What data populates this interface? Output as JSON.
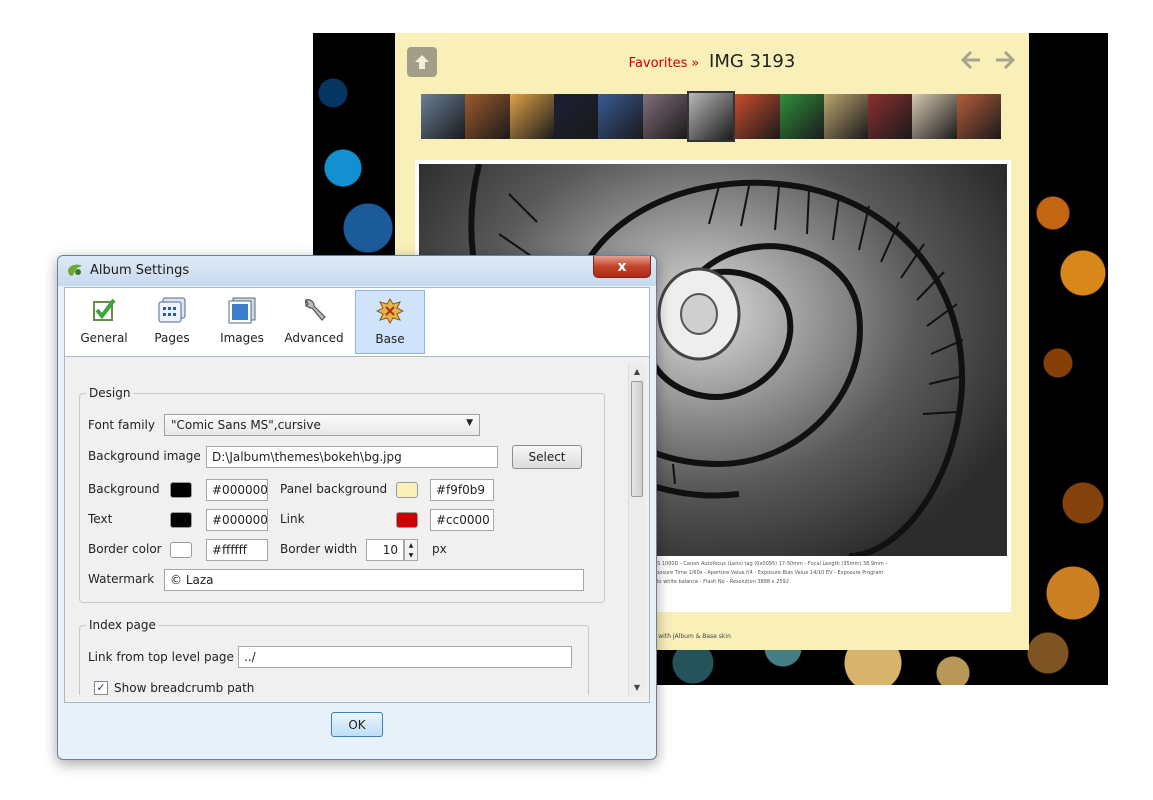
{
  "gallery": {
    "breadcrumb_parent": "Favorites",
    "breadcrumb_separator": "»",
    "image_title": "IMG 3193",
    "thumb_colors": [
      "#6a7f99",
      "#9d5b2b",
      "#e0a247",
      "#1b1f35",
      "#385a95",
      "#826e7b",
      "#b8b8b8",
      "#c84c2b",
      "#2f8f3b",
      "#bca46f",
      "#8c2f2f",
      "#d8c7b2",
      "#b45c3a"
    ],
    "active_thumb": 6,
    "caption_lines": [
      "EOS 1000D - Canon Autofocus (Lens) tag (0x0095) 17-50mm - Focal Length (35mm) 38.9mm -",
      "Exposure Time 1/60s - Aperture Value f/4 - Exposure Bias Value 14/10 EV - Exposure Program",
      "Auto white balance - Flash No - Resolution 3888 x 2592"
    ],
    "credit": "Made with jAlbum & Base skin",
    "accent_color": "#cc0000"
  },
  "dialog": {
    "title": "Album Settings",
    "close_label": "x",
    "tabs": [
      {
        "label": "General",
        "icon": "general-icon"
      },
      {
        "label": "Pages",
        "icon": "pages-icon"
      },
      {
        "label": "Images",
        "icon": "images-icon"
      },
      {
        "label": "Advanced",
        "icon": "wrench-icon"
      },
      {
        "label": "Base",
        "icon": "base-skin-icon"
      }
    ],
    "selected_tab": "Base",
    "design": {
      "legend": "Design",
      "font_family_label": "Font family",
      "font_family_value": "\"Comic Sans MS\",cursive",
      "bg_image_label": "Background image",
      "bg_image_value": "D:\\Jalbum\\themes\\bokeh\\bg.jpg",
      "select_button": "Select",
      "background_label": "Background",
      "background_value": "#000000",
      "panel_bg_label": "Panel background",
      "panel_bg_value": "#f9f0b9",
      "text_label": "Text",
      "text_value": "#000000",
      "link_label": "Link",
      "link_value": "#cc0000",
      "border_color_label": "Border color",
      "border_color_value": "#ffffff",
      "border_width_label": "Border width",
      "border_width_value": "10",
      "border_width_unit": "px",
      "watermark_label": "Watermark",
      "watermark_value": "© Laza"
    },
    "index_page": {
      "legend": "Index page",
      "link_label": "Link from top level page",
      "link_value": "../",
      "breadcrumb_label": "Show breadcrumb path",
      "breadcrumb_checked": true
    },
    "ok_label": "OK"
  }
}
